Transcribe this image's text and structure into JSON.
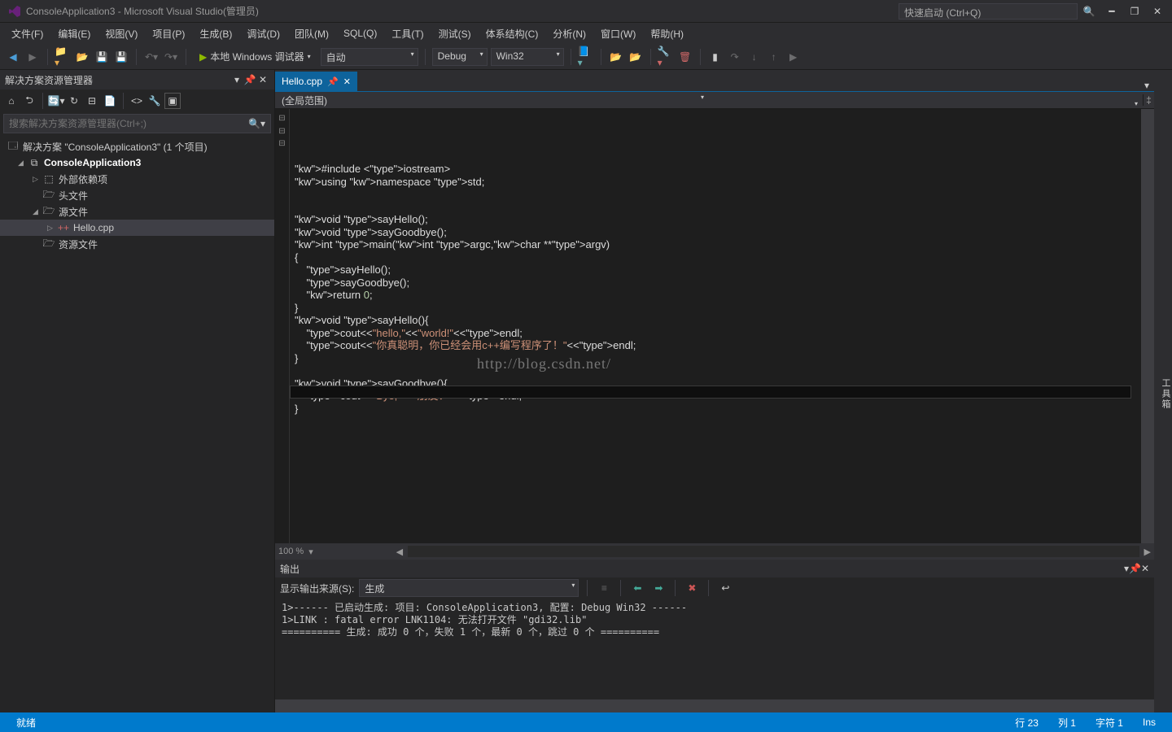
{
  "titlebar": {
    "title": "ConsoleApplication3 - Microsoft Visual Studio(管理员)",
    "quicklaunch_placeholder": "快速启动 (Ctrl+Q)"
  },
  "menu": [
    "文件(F)",
    "编辑(E)",
    "视图(V)",
    "项目(P)",
    "生成(B)",
    "调试(D)",
    "团队(M)",
    "SQL(Q)",
    "工具(T)",
    "测试(S)",
    "体系结构(C)",
    "分析(N)",
    "窗口(W)",
    "帮助(H)"
  ],
  "toolbar": {
    "run_label": "本地 Windows 调试器",
    "combo1": "自动",
    "combo2": "Debug",
    "combo3": "Win32"
  },
  "solution": {
    "panel_title": "解决方案资源管理器",
    "search_placeholder": "搜索解决方案资源管理器(Ctrl+;)",
    "root": "解决方案 \"ConsoleApplication3\" (1 个项目)",
    "project": "ConsoleApplication3",
    "items": [
      "外部依赖项",
      "头文件",
      "源文件",
      "资源文件"
    ],
    "file": "Hello.cpp"
  },
  "tab": {
    "label": "Hello.cpp"
  },
  "navbar": {
    "scope": "(全局范围)"
  },
  "zoom": "100 %",
  "watermark": "http://blog.csdn.net/",
  "code_lines": [
    {
      "t": "#include <iostream>",
      "fold": ""
    },
    {
      "t": "using namespace std;",
      "fold": ""
    },
    {
      "t": "",
      "fold": ""
    },
    {
      "t": "",
      "fold": ""
    },
    {
      "t": "void sayHello();",
      "fold": ""
    },
    {
      "t": "void sayGoodbye();",
      "fold": ""
    },
    {
      "t": "int main(int argc,char **argv)",
      "fold": "⊟"
    },
    {
      "t": "{",
      "fold": ""
    },
    {
      "t": "    sayHello();",
      "fold": ""
    },
    {
      "t": "    sayGoodbye();",
      "fold": ""
    },
    {
      "t": "    return 0;",
      "fold": ""
    },
    {
      "t": "}",
      "fold": ""
    },
    {
      "t": "void sayHello(){",
      "fold": "⊟"
    },
    {
      "t": "    cout<<\"hello,\"<<\"world!\"<<endl;",
      "fold": ""
    },
    {
      "t": "    cout<<\"你真聪明，你已经会用c++编写程序了！\"<<endl;",
      "fold": ""
    },
    {
      "t": "}",
      "fold": ""
    },
    {
      "t": "",
      "fold": ""
    },
    {
      "t": "void sayGoodbye(){",
      "fold": "⊟"
    },
    {
      "t": "    cout<<\"Bye,\"<<\"朋友！\"<<endl;",
      "fold": ""
    },
    {
      "t": "}",
      "fold": ""
    }
  ],
  "output": {
    "title": "输出",
    "source_label": "显示输出来源(S):",
    "source_value": "生成",
    "lines": [
      "1>------ 已启动生成: 项目: ConsoleApplication3, 配置: Debug Win32 ------",
      "1>LINK : fatal error LNK1104: 无法打开文件 \"gdi32.lib\"",
      "========== 生成: 成功 0 个，失败 1 个，最新 0 个，跳过 0 个 =========="
    ]
  },
  "status": {
    "ready": "就绪",
    "line": "行 23",
    "col": "列 1",
    "char": "字符 1",
    "ins": "Ins"
  },
  "rightbar": "工具箱"
}
